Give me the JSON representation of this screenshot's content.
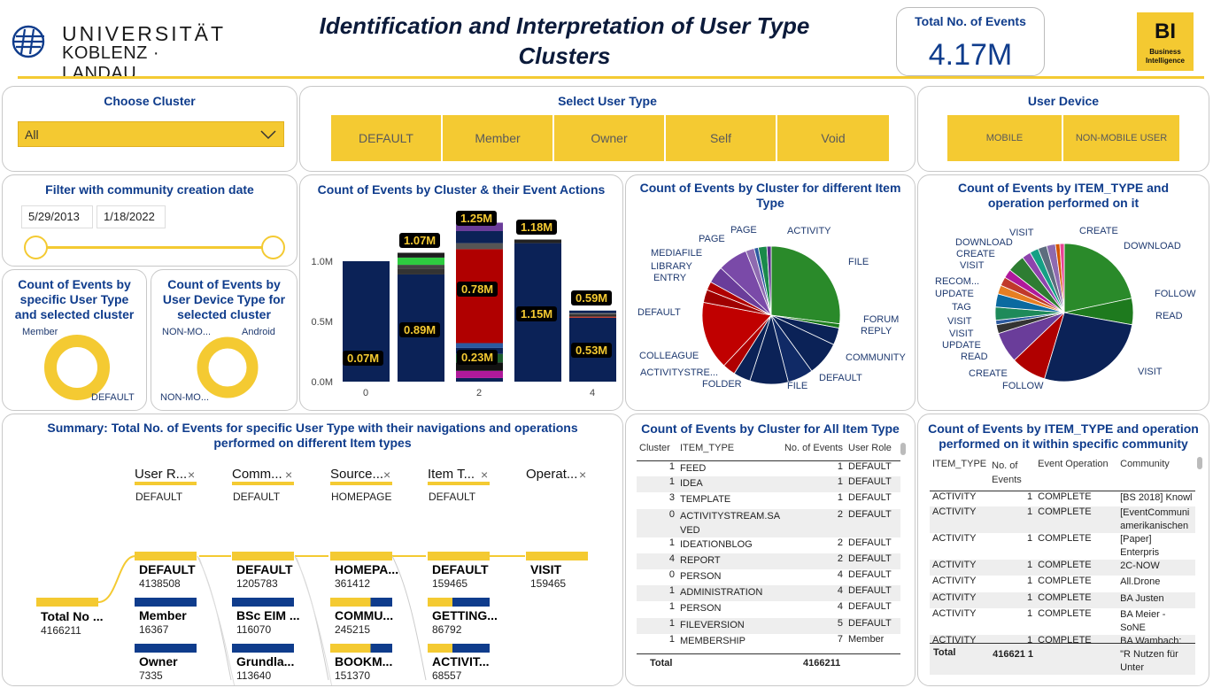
{
  "header": {
    "logo_line1": "UNIVERSITÄT",
    "logo_line2": "KOBLENZ · LANDAU",
    "title": "Identification and Interpretation of User Type Clusters",
    "kpi_label": "Total No. of Events",
    "kpi_value": "4.17M",
    "bi_big": "BI",
    "bi_small": "Business Intelligence"
  },
  "choose_cluster": {
    "title": "Choose Cluster",
    "selected": "All"
  },
  "user_type": {
    "title": "Select User Type",
    "options": [
      "DEFAULT",
      "Member",
      "Owner",
      "Self",
      "Void"
    ]
  },
  "user_device": {
    "title": "User Device",
    "options": [
      "MOBILE",
      "NON-MOBILE USER"
    ]
  },
  "date_filter": {
    "title": "Filter with community creation date",
    "start": "5/29/2013",
    "end": "1/18/2022"
  },
  "donut1": {
    "title": "Count of Events by specific User Type and selected cluster",
    "labels": [
      "Member",
      "DEFAULT"
    ]
  },
  "donut2": {
    "title": "Count of Events by User Device Type for selected cluster",
    "labels": [
      "NON-MO...",
      "Android",
      "NON-MO..."
    ]
  },
  "bar_chart": {
    "title": "Count of Events by Cluster & their Event Actions"
  },
  "pie1": {
    "title": "Count of Events by Cluster for different Item Type",
    "labels": [
      "PAGE",
      "ACTIVITY",
      "PAGE",
      "MEDIAFILE",
      "LIBRARY",
      "ENTRY",
      "FILE",
      "DEFAULT",
      "FORUM",
      "REPLY",
      "COLLEAGUE",
      "COMMUNITY",
      "ACTIVITYSTRE...",
      "DEFAULT",
      "FOLDER",
      "FILE"
    ]
  },
  "pie2": {
    "title": "Count of Events by ITEM_TYPE and operation performed on it",
    "labels": [
      "VISIT",
      "CREATE",
      "DOWNLOAD",
      "DOWNLOAD",
      "CREATE",
      "VISIT",
      "FOLLOW",
      "RECOM...",
      "UPDATE",
      "READ",
      "TAG",
      "VISIT",
      "VISIT",
      "UPDATE",
      "READ",
      "VISIT",
      "CREATE",
      "FOLLOW"
    ]
  },
  "chart_data": [
    {
      "type": "bar",
      "title": "Count of Events by Cluster & their Event Actions",
      "categories": [
        "0",
        "1",
        "2",
        "3",
        "4"
      ],
      "totals": [
        0.07,
        1.07,
        1.25,
        1.18,
        0.59
      ],
      "segment_labels": {
        "1": [
          0.89
        ],
        "2": [
          0.78,
          0.23
        ],
        "3": [
          1.15
        ],
        "4": [
          0.53
        ]
      },
      "ylim": [
        0,
        1.3
      ],
      "ytick_labels": [
        "0.0M",
        "0.5M",
        "1.0M"
      ],
      "xtick_labels": [
        "0",
        "2",
        "4"
      ],
      "value_labels": [
        "0.07M",
        "1.07M",
        "1.25M",
        "1.18M",
        "0.59M",
        "0.89M",
        "0.78M",
        "0.23M",
        "1.15M",
        "0.53M"
      ]
    },
    {
      "type": "pie",
      "title": "Count of Events by Cluster for different Item Type"
    },
    {
      "type": "pie",
      "title": "Count of Events by ITEM_TYPE and operation performed on it"
    }
  ],
  "summary": {
    "title": "Summary: Total No. of Events for specific User Type with their navigations and operations performed on different Item types",
    "headers": [
      "User R...",
      "Comm...",
      "Source...",
      "Item T...",
      "Operat..."
    ],
    "subs": [
      "DEFAULT",
      "DEFAULT",
      "HOMEPAGE",
      "DEFAULT",
      ""
    ],
    "root": {
      "name": "Total No ...",
      "value": "4166211"
    },
    "col1": [
      {
        "name": "DEFAULT",
        "value": "4138508"
      },
      {
        "name": "Member",
        "value": "16367"
      },
      {
        "name": "Owner",
        "value": "7335"
      }
    ],
    "col2": [
      {
        "name": "DEFAULT",
        "value": "1205783"
      },
      {
        "name": "BSc EIM ...",
        "value": "116070"
      },
      {
        "name": "Grundla...",
        "value": "113640"
      }
    ],
    "col3": [
      {
        "name": "HOMEPA...",
        "value": "361412"
      },
      {
        "name": "COMMU...",
        "value": "245215"
      },
      {
        "name": "BOOKM...",
        "value": "151370"
      }
    ],
    "col4": [
      {
        "name": "DEFAULT",
        "value": "159465"
      },
      {
        "name": "GETTING...",
        "value": "86792"
      },
      {
        "name": "ACTIVIT...",
        "value": "68557"
      }
    ],
    "col5": [
      {
        "name": "VISIT",
        "value": "159465"
      }
    ]
  },
  "table1": {
    "title": "Count of Events by Cluster for All Item Type",
    "headers": [
      "Cluster",
      "ITEM_TYPE",
      "No. of Events",
      "User Role"
    ],
    "rows": [
      [
        "1",
        "FEED",
        "1",
        "DEFAULT"
      ],
      [
        "1",
        "IDEA",
        "1",
        "DEFAULT"
      ],
      [
        "3",
        "TEMPLATE",
        "1",
        "DEFAULT"
      ],
      [
        "0",
        "ACTIVITYSTREAM.SA VED",
        "2",
        "DEFAULT"
      ],
      [
        "1",
        "IDEATIONBLOG",
        "2",
        "DEFAULT"
      ],
      [
        "4",
        "REPORT",
        "2",
        "DEFAULT"
      ],
      [
        "0",
        "PERSON",
        "4",
        "DEFAULT"
      ],
      [
        "1",
        "ADMINISTRATION",
        "4",
        "DEFAULT"
      ],
      [
        "1",
        "PERSON",
        "4",
        "DEFAULT"
      ],
      [
        "1",
        "FILEVERSION",
        "5",
        "DEFAULT"
      ],
      [
        "1",
        "MEMBERSHIP",
        "7",
        "Member"
      ]
    ],
    "total_label": "Total",
    "total_value": "4166211"
  },
  "table2": {
    "title": "Count of Events by ITEM_TYPE and operation performed on it within specific community",
    "headers": [
      "ITEM_TYPE",
      "No. of Events",
      "Event Operation",
      "Community"
    ],
    "rows": [
      [
        "ACTIVITY",
        "1",
        "COMPLETE",
        "[BS 2018] Knowl"
      ],
      [
        "ACTIVITY",
        "1",
        "COMPLETE",
        "[EventCommuni amerikanischen"
      ],
      [
        "ACTIVITY",
        "1",
        "COMPLETE",
        "[Paper] Enterpris"
      ],
      [
        "ACTIVITY",
        "1",
        "COMPLETE",
        "2C-NOW"
      ],
      [
        "ACTIVITY",
        "1",
        "COMPLETE",
        "All.Drone"
      ],
      [
        "ACTIVITY",
        "1",
        "COMPLETE",
        "BA Justen"
      ],
      [
        "ACTIVITY",
        "1",
        "COMPLETE",
        "BA Meier - SoNE"
      ],
      [
        "ACTIVITY",
        "1",
        "COMPLETE",
        "BA Wambach: \"R Nutzen für Unter"
      ]
    ],
    "total_label": "Total",
    "total_value": "416621 1"
  }
}
